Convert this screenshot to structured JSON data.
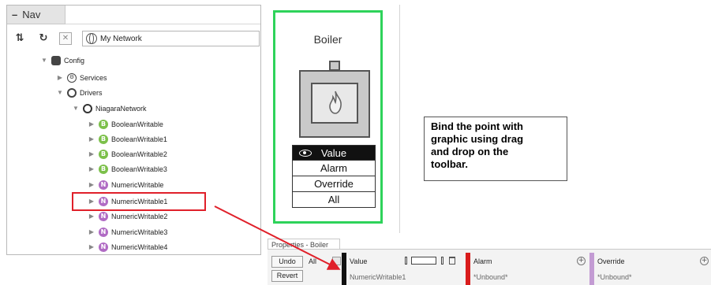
{
  "nav": {
    "tab_label": "Nav",
    "path_text": "My Network",
    "tree": [
      {
        "label": "Config",
        "icon": "database-icon",
        "expanded": true
      },
      {
        "label": "Services",
        "icon": "services-icon",
        "expanded": false
      },
      {
        "label": "Drivers",
        "icon": "drivers-icon",
        "expanded": true
      },
      {
        "label": "NiagaraNetwork",
        "icon": "network-icon",
        "expanded": true
      },
      {
        "label": "BooleanWritable",
        "icon": "boolean-point-icon",
        "badge": "B"
      },
      {
        "label": "BooleanWritable1",
        "icon": "boolean-point-icon",
        "badge": "B"
      },
      {
        "label": "BooleanWritable2",
        "icon": "boolean-point-icon",
        "badge": "B"
      },
      {
        "label": "BooleanWritable3",
        "icon": "boolean-point-icon",
        "badge": "B"
      },
      {
        "label": "NumericWritable",
        "icon": "numeric-point-icon",
        "badge": "N"
      },
      {
        "label": "NumericWritable1",
        "icon": "numeric-point-icon",
        "badge": "N",
        "highlighted": true
      },
      {
        "label": "NumericWritable2",
        "icon": "numeric-point-icon",
        "badge": "N"
      },
      {
        "label": "NumericWritable3",
        "icon": "numeric-point-icon",
        "badge": "N"
      },
      {
        "label": "NumericWritable4",
        "icon": "numeric-point-icon",
        "badge": "N"
      }
    ]
  },
  "graphic": {
    "title": "Boiler",
    "rows": [
      "Value",
      "Alarm",
      "Override",
      "All"
    ]
  },
  "callout": {
    "text": "Bind the point with\ngraphic using drag\nand drop on the\ntoolbar."
  },
  "properties": {
    "tab_label": "Properties - Boiler",
    "undo_label": "Undo",
    "revert_label": "Revert",
    "all_label": "All",
    "columns": [
      {
        "header": "Value",
        "value": "NumericWritable1",
        "color": "#111111"
      },
      {
        "header": "Alarm",
        "value": "*Unbound*",
        "color": "#d91c1c"
      },
      {
        "header": "Override",
        "value": "*Unbound*",
        "color": "#c39bd3"
      }
    ]
  },
  "colors": {
    "highlight": "#e0202a",
    "graphic_border": "#2ed35a",
    "boolean_badge": "#7cc04a",
    "numeric_badge": "#b06bc4"
  }
}
